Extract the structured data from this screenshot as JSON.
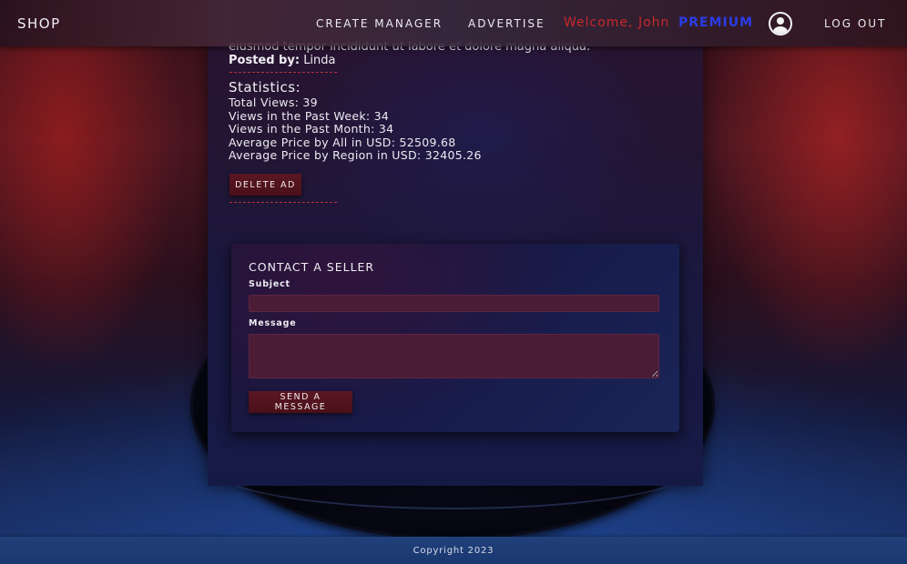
{
  "header": {
    "brand": "SHOP",
    "nav": {
      "create_manager": "CREATE MANAGER",
      "advertise": "ADVERTISE",
      "logout": "LOG OUT"
    },
    "welcome": "Welcome, John",
    "premium": "PREMIUM",
    "avatar_icon": "user-circle-icon"
  },
  "ad": {
    "description_tail": "eiusmod tempor incididunt ut labore et dolore magna aliqua.",
    "posted_by_label": "Posted by:",
    "posted_by_value": "Linda",
    "statistics": {
      "title": "Statistics:",
      "lines": [
        "Total Views: 39",
        "Views in the Past Week: 34",
        "Views in the Past Month: 34",
        "Average Price by All in USD: 52509.68",
        "Average Price by Region in USD: 32405.26"
      ]
    },
    "delete_label": "DELETE AD"
  },
  "contact": {
    "title": "CONTACT A SELLER",
    "subject_label": "Subject",
    "subject_value": "",
    "message_label": "Message",
    "message_value": "",
    "send_label": "SEND A MESSAGE"
  },
  "footer": {
    "copyright": "Copyright 2023"
  },
  "colors": {
    "welcome": "#c8282c",
    "premium": "#2a3ce6",
    "button": "#4a101a",
    "input": "#4a1c36",
    "footer": "#21407a"
  }
}
